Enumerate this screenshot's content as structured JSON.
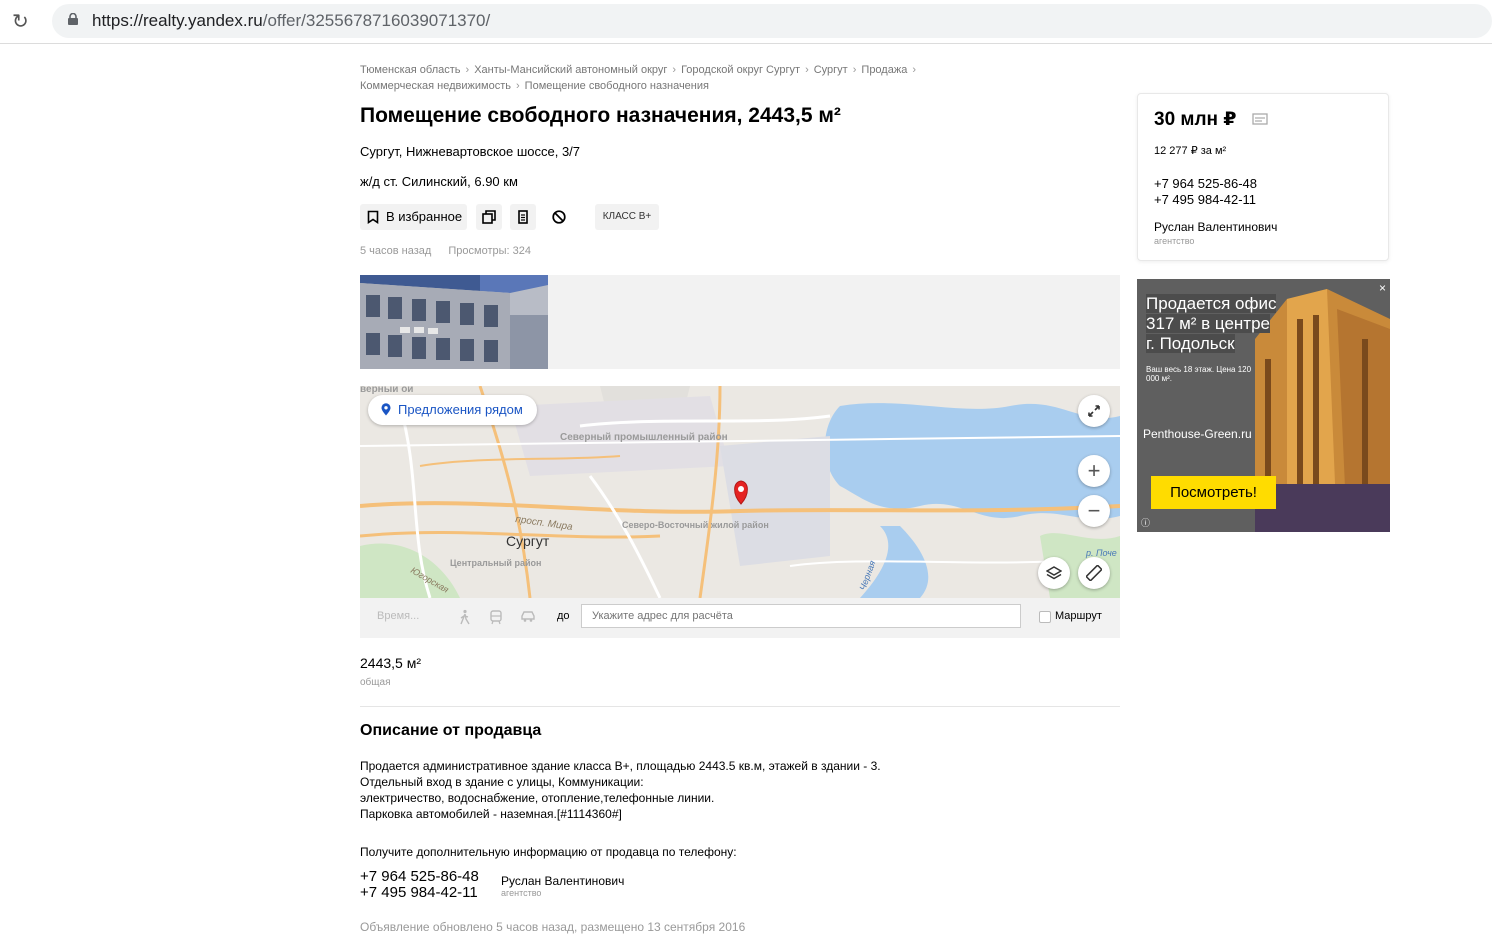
{
  "browser": {
    "url_host": "https://realty.yandex.ru",
    "url_path": "/offer/3255678716039071370/"
  },
  "breadcrumbs": [
    "Тюменская область",
    "Ханты-Мансийский автономный округ",
    "Городской округ Сургут",
    "Сургут",
    "Продажа",
    "Коммерческая недвижимость",
    "Помещение свободного назначения"
  ],
  "offer": {
    "title": "Помещение свободного назначения, 2443,5 м²",
    "address": "Сургут, Нижневартовское шоссе, 3/7",
    "station": "ж/д ст. Силинский, 6.90 км",
    "favorite_label": "В избранное",
    "class_badge": "КЛАСС В+",
    "published_ago": "5 часов назад",
    "views": "Просмотры: 324"
  },
  "map": {
    "nearby_label": "Предложения рядом",
    "labels": {
      "north_area": "Северный промышленный район",
      "prosp_mira": "просп. Мира",
      "city": "Сургут",
      "northeast": "Северо-Восточный жилой район",
      "central": "Центральный район",
      "yugorskaya": "Югорская",
      "river": "р. Поче",
      "chernaya": "Черная",
      "top_left": "верный ой"
    }
  },
  "route": {
    "time_label": "Время...",
    "to_label": "до",
    "input_placeholder": "Укажите адрес для расчёта",
    "route_checkbox_label": "Маршрут"
  },
  "area": {
    "value": "2443,5 м²",
    "label": "общая"
  },
  "description": {
    "title": "Описание от продавца",
    "lines": [
      "Продается административное здание класса В+, площадью 2443.5 кв.м, этажей в здании - 3.",
      "Отдельный вход в здание с улицы, Коммуникации:",
      "электричество, водоснабжение, отопление,телефонные линии.",
      "Парковка автомобилей - наземная.[#1114360#]"
    ],
    "contact_hint": "Получите дополнительную информацию от продавца по телефону:"
  },
  "seller": {
    "phone1": "+7 964 525-86-48",
    "phone2": "+7 495 984-42-11",
    "name": "Руслан Валентинович",
    "type": "агентство"
  },
  "updated_text": "Объявление обновлено 5 часов назад, размещено 13 сентября 2016",
  "price_card": {
    "price": "30 млн ₽",
    "per_m2": "12 277 ₽ за м²"
  },
  "ad": {
    "headline_1": "Продается офис",
    "headline_2": "317 м² в центре",
    "headline_3": "г. Подольск",
    "sub": "Ваш весь 18 этаж. Цена 120 000 м².",
    "domain": "Penthouse-Green.ru",
    "button": "Посмотреть!",
    "close": "×",
    "info": "ⓘ"
  },
  "colors": {
    "link_blue": "#1a55c4",
    "ad_button": "#ffdc00",
    "map_pin": "#e52222"
  }
}
